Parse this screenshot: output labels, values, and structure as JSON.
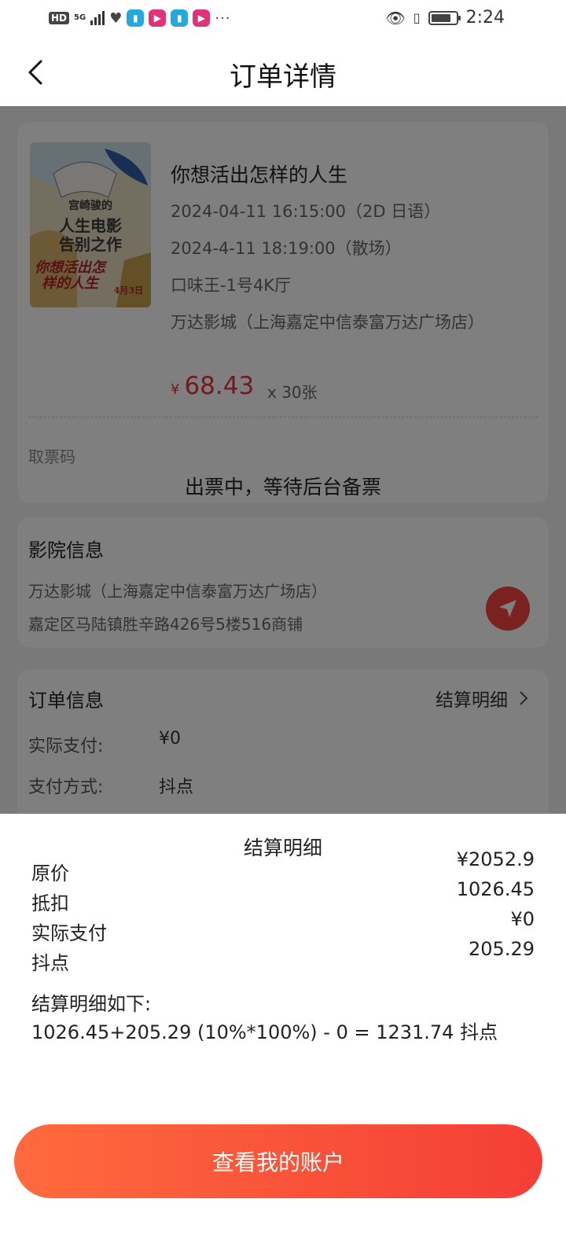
{
  "status_bar": {
    "hd": "HD",
    "network": "5G",
    "time": "2:24",
    "battery_level": 0.8,
    "icons": [
      "signal-icon",
      "heart-icon",
      "book-app-icon",
      "video-app-icon",
      "book-app-icon",
      "video-app-icon",
      "more-icon",
      "eye-icon",
      "vibrate-icon",
      "battery-icon"
    ]
  },
  "header": {
    "title": "订单详情"
  },
  "movie": {
    "poster": {
      "line1": "宫崎骏的",
      "line2": "人生电影",
      "line3": "告别之作",
      "line4": "你想活出怎样的人生",
      "line5": "4月3日"
    },
    "title": "你想活出怎样的人生",
    "showtime": "2024-04-11 16:15:00（2D 日语）",
    "end_time": "2024-4-11 18:19:00（散场）",
    "hall": "口味王-1号4K厅",
    "cinema": "万达影城（上海嘉定中信泰富万达广场店）",
    "price_symbol": "¥",
    "price": "68.43",
    "quantity": "x 30张",
    "ticket_code_label": "取票码",
    "ticket_status": "出票中，等待后台备票"
  },
  "cinema_info": {
    "title": "影院信息",
    "name": "万达影城（上海嘉定中信泰富万达广场店）",
    "address": "嘉定区马陆镇胜辛路426号5楼516商铺"
  },
  "order_info": {
    "title": "订单信息",
    "detail_link": "结算明细",
    "rows": [
      {
        "label": "实际支付:",
        "value": "¥0"
      },
      {
        "label": "支付方式:",
        "value": "抖点"
      }
    ]
  },
  "settlement": {
    "title": "结算明细",
    "rows": [
      {
        "label": "原价",
        "value": "¥2052.9"
      },
      {
        "label": "抵扣",
        "value": "1026.45"
      },
      {
        "label": "实际支付",
        "value": "¥0"
      },
      {
        "label": "抖点",
        "value": "205.29"
      }
    ],
    "note_label": "结算明细如下:",
    "formula": "1026.45+205.29 (10%*100%) - 0 = 1231.74 抖点",
    "button": "查看我的账户"
  },
  "colors": {
    "accent": "#e8333d",
    "button_start": "#ff6a3d",
    "button_end": "#f43e36"
  }
}
